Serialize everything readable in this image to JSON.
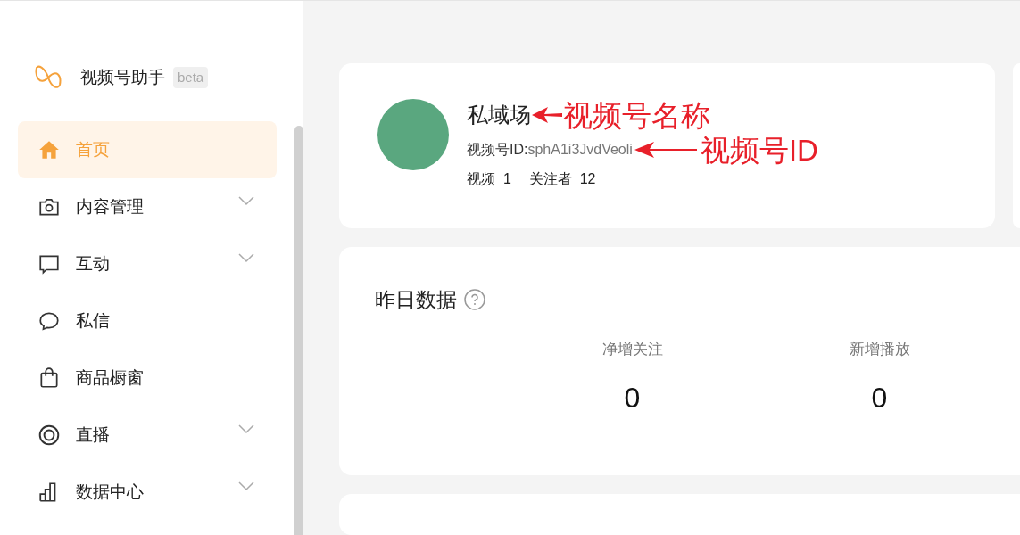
{
  "app": {
    "name": "视频号助手",
    "badge": "beta"
  },
  "sidebar": {
    "items": [
      {
        "label": "首页",
        "kind": "home",
        "selected": true,
        "expandable": false
      },
      {
        "label": "内容管理",
        "kind": "camera",
        "selected": false,
        "expandable": true
      },
      {
        "label": "互动",
        "kind": "comment",
        "selected": false,
        "expandable": true
      },
      {
        "label": "私信",
        "kind": "message",
        "selected": false,
        "expandable": false
      },
      {
        "label": "商品橱窗",
        "kind": "bag",
        "selected": false,
        "expandable": false
      },
      {
        "label": "直播",
        "kind": "ring",
        "selected": false,
        "expandable": true
      },
      {
        "label": "数据中心",
        "kind": "bars",
        "selected": false,
        "expandable": true
      }
    ]
  },
  "profile": {
    "name": "私域场",
    "id_label": "视频号ID:",
    "id_value": "sphA1i3JvdVeoli",
    "stats": [
      {
        "label": "视频",
        "value": "1"
      },
      {
        "label": "关注者",
        "value": "12"
      }
    ]
  },
  "annotations": [
    {
      "text": "视频号名称"
    },
    {
      "text": "视频号ID"
    }
  ],
  "yesterday": {
    "title": "昨日数据",
    "metrics": [
      {
        "label": "净增关注",
        "value": "0"
      },
      {
        "label": "新增播放",
        "value": "0"
      }
    ]
  }
}
